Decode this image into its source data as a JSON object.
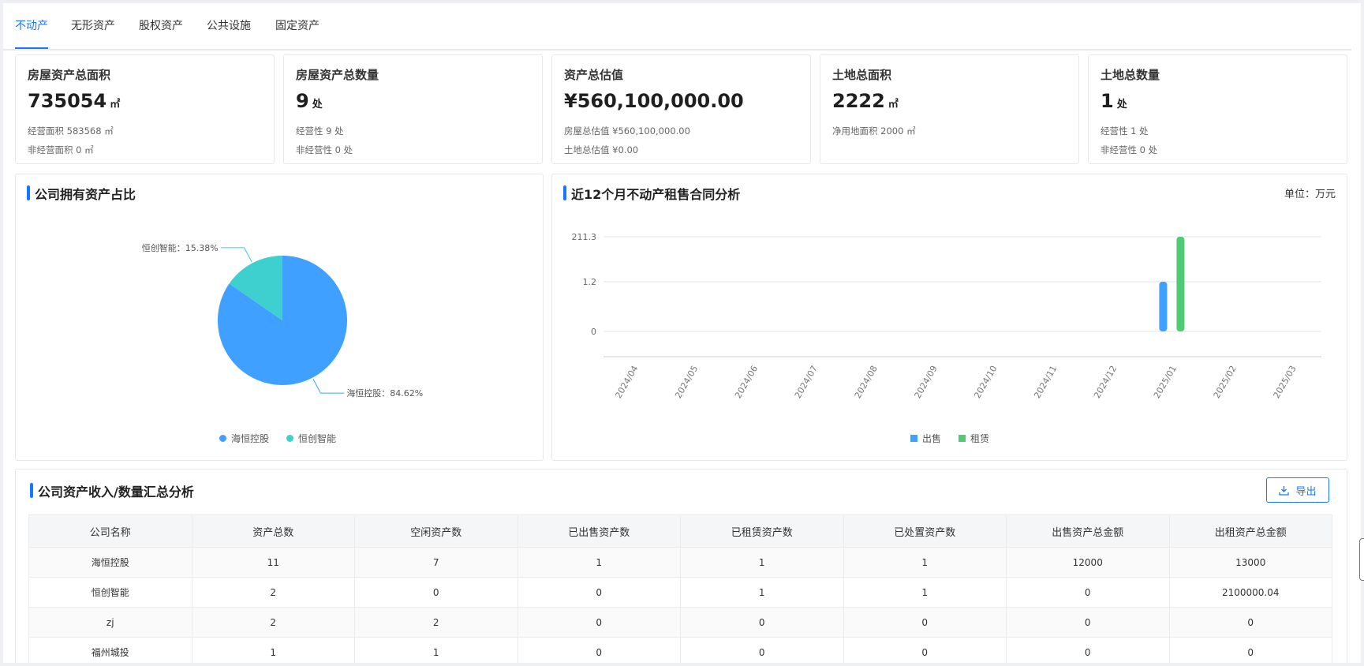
{
  "tabs": [
    "不动产",
    "无形资产",
    "股权资产",
    "公共设施",
    "固定资产"
  ],
  "cards": [
    {
      "title": "房屋资产总面积",
      "value": "735054",
      "unit": "㎡",
      "sub1": "经营面积 583568 ㎡",
      "sub2": "非经营面积 0 ㎡"
    },
    {
      "title": "房屋资产总数量",
      "value": "9",
      "unit": "处",
      "sub1": "经营性 9 处",
      "sub2": "非经营性 0 处"
    },
    {
      "title": "资产总估值",
      "value": "¥560,100,000.00",
      "unit": "",
      "sub1": "房屋总估值 ¥560,100,000.00",
      "sub2": "土地总估值 ¥0.00"
    },
    {
      "title": "土地总面积",
      "value": "2222",
      "unit": "㎡",
      "sub1": "净用地面积 2000 ㎡",
      "sub2": ""
    },
    {
      "title": "土地总数量",
      "value": "1",
      "unit": "处",
      "sub1": "经营性 1 处",
      "sub2": "非经营性 0 处"
    }
  ],
  "pie_panel": {
    "title": "公司拥有资产占比",
    "slice_labels": [
      "海恒控股：84.62%",
      "恒创智能：15.38%"
    ]
  },
  "bar_panel": {
    "title": "近12个月不动产租售合同分析",
    "unit": "单位：万元"
  },
  "table_panel": {
    "title": "公司资产收入/数量汇总分析",
    "export_label": "导出",
    "columns": [
      "公司名称",
      "资产总数",
      "空闲资产数",
      "已出售资产数",
      "已租赁资产数",
      "已处置资产数",
      "出售资产总金额",
      "出租资产总金额"
    ],
    "rows": [
      [
        "海恒控股",
        "11",
        "7",
        "1",
        "1",
        "1",
        "12000",
        "13000"
      ],
      [
        "恒创智能",
        "2",
        "0",
        "0",
        "1",
        "1",
        "0",
        "2100000.04"
      ],
      [
        "zj",
        "2",
        "2",
        "0",
        "0",
        "0",
        "0",
        "0"
      ],
      [
        "福州城投",
        "1",
        "1",
        "0",
        "0",
        "0",
        "0",
        "0"
      ]
    ]
  },
  "chart_data": [
    {
      "type": "pie",
      "categories": [
        "海恒控股",
        "恒创智能"
      ],
      "values": [
        84.62,
        15.38
      ],
      "colors": [
        "#40a0ff",
        "#3ecfcf"
      ],
      "legend": "bottom"
    },
    {
      "type": "bar",
      "categories": [
        "2024/04",
        "2024/05",
        "2024/06",
        "2024/07",
        "2024/08",
        "2024/09",
        "2024/10",
        "2024/11",
        "2024/12",
        "2025/01",
        "2025/02",
        "2025/03"
      ],
      "series": [
        {
          "name": "出售",
          "color": "#40a0ff",
          "values": [
            0,
            0,
            0,
            0,
            0,
            0,
            0,
            0,
            0,
            1.2,
            0,
            0
          ]
        },
        {
          "name": "租赁",
          "color": "#4ecb73",
          "values": [
            0,
            0,
            0,
            0,
            0,
            0,
            0,
            0,
            0,
            211.3,
            0,
            0
          ]
        }
      ],
      "yticks": [
        "0",
        "1.2",
        "211.3"
      ],
      "legend": "bottom",
      "grid": true
    }
  ]
}
